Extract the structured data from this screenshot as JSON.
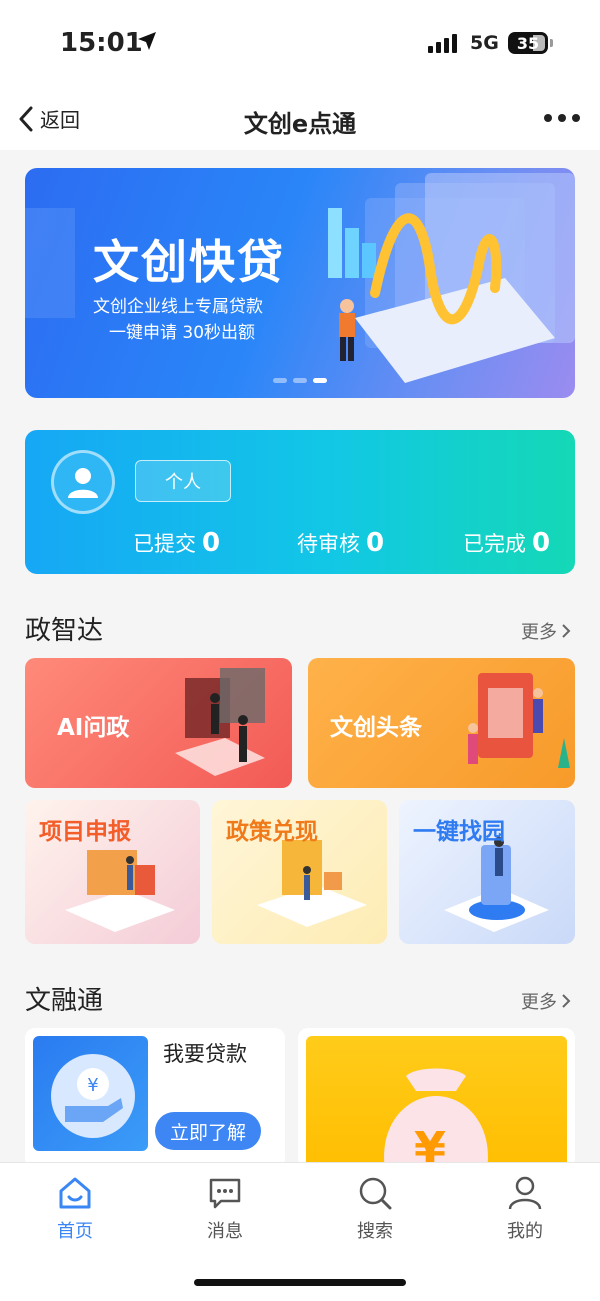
{
  "status": {
    "time": "15:01",
    "network": "5G",
    "battery": "35"
  },
  "nav": {
    "back_label": "返回",
    "title": "文创e点通"
  },
  "banner": {
    "title": "文创快贷",
    "line1": "文创企业线上专属贷款",
    "line2": "一键申请 30秒出额"
  },
  "user_card": {
    "tag": "个人",
    "stats": [
      {
        "label": "已提交",
        "value": "0"
      },
      {
        "label": "待审核",
        "value": "0"
      },
      {
        "label": "已完成",
        "value": "0"
      }
    ]
  },
  "section1": {
    "title": "政智达",
    "more": "更多"
  },
  "tiles": {
    "ai": "AI问政",
    "news": "文创头条",
    "project": "项目申报",
    "policy": "政策兑现",
    "park": "一键找园"
  },
  "section2": {
    "title": "文融通",
    "more": "更多"
  },
  "finance": {
    "title": "我要贷款",
    "button": "立即了解",
    "yen": "¥"
  },
  "tabbar": [
    {
      "label": "首页"
    },
    {
      "label": "消息"
    },
    {
      "label": "搜索"
    },
    {
      "label": "我的"
    }
  ],
  "colors": {
    "accent": "#3a86f5"
  }
}
